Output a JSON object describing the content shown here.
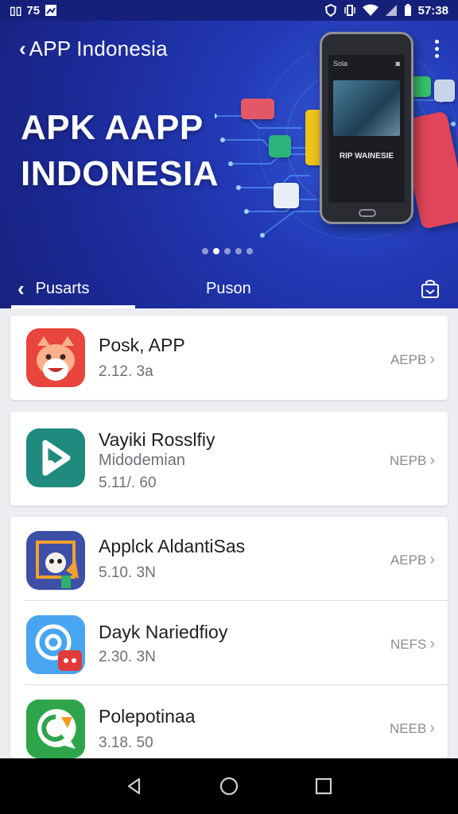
{
  "status_bar": {
    "left_text": "75",
    "time": "57:38"
  },
  "header": {
    "title": "APP Indonesia"
  },
  "banner": {
    "hero_line_1": "APK AAPP",
    "hero_line_2": "INDONESIA",
    "phone_top_text": "Sola",
    "phone_caption": "RIP WAINESIE",
    "page_indicator": {
      "total": 5,
      "active": 1
    }
  },
  "tabs": [
    {
      "label": "Pusarts",
      "selected": true
    },
    {
      "label": "Puson",
      "selected": false
    }
  ],
  "apps": [
    {
      "name": "Posk, APP",
      "subtitle": "",
      "meta": "2.12. 3a",
      "action": "AEPB",
      "icon": "fox-icon",
      "color": "#e8453c"
    },
    {
      "name": "Vayiki Rosslfiy",
      "subtitle": "Midodemian",
      "meta": "5.11/. 60",
      "action": "NEPB",
      "icon": "play-arrow-icon",
      "color": "#1f8a7e"
    },
    {
      "name": "Applck AldantiSas",
      "subtitle": "",
      "meta": "5.10. 3N",
      "action": "AEPB",
      "icon": "character-icon",
      "color": "#3e4fa8"
    },
    {
      "name": "Dayk Nariedfioy",
      "subtitle": "",
      "meta": "2.30. 3N",
      "action": "NEFS",
      "icon": "camera-lens-icon",
      "color": "#3b8fe0"
    },
    {
      "name": "Polepotinaa",
      "subtitle": "",
      "meta": "3.18. 50",
      "action": "NEEB",
      "icon": "chat-bubble-icon",
      "color": "#3aa04a"
    }
  ],
  "colors": {
    "banner_blue": "#1c2a98",
    "status_bar": "#14207a",
    "background": "#eceef2"
  }
}
